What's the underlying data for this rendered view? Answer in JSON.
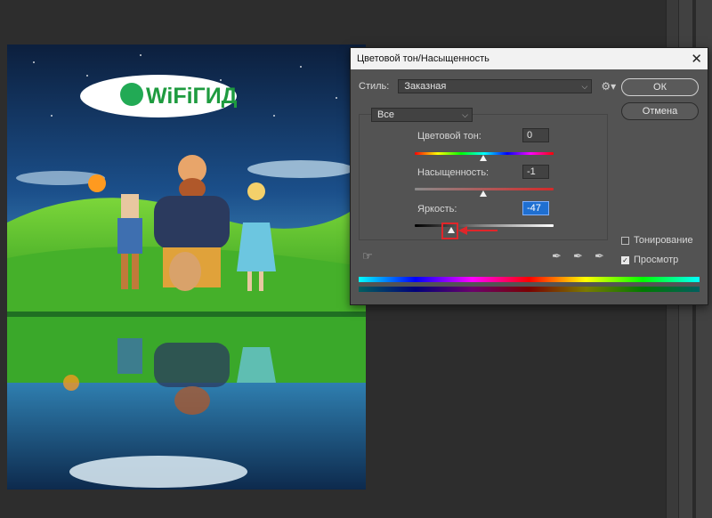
{
  "dialog": {
    "title": "Цветовой тон/Насыщенность",
    "close_symbol": "✕",
    "style_label": "Стиль:",
    "style_value": "Заказная",
    "ok_label": "ОК",
    "cancel_label": "Отмена",
    "channel_value": "Все",
    "hue": {
      "label": "Цветовой тон:",
      "value": "0"
    },
    "saturation": {
      "label": "Насыщенность:",
      "value": "-1"
    },
    "lightness": {
      "label": "Яркость:",
      "value": "-47"
    },
    "colorize_label": "Тонирование",
    "preview_label": "Просмотр",
    "colorize_checked": false,
    "preview_checked": true
  },
  "icons": {
    "close": "close-icon",
    "dropdown": "chevron-down-icon",
    "settings": "gear-icon",
    "target_adjust": "hand-pointer-icon",
    "eyedropper": "eyedropper-icon",
    "eyedropper_plus": "eyedropper-plus-icon",
    "eyedropper_minus": "eyedropper-minus-icon"
  },
  "document": {
    "logo_text": "WiFiГИД"
  },
  "colors": {
    "dialog_bg": "#535353",
    "highlight": "#e0262a",
    "active_field": "#1f6fd1"
  }
}
